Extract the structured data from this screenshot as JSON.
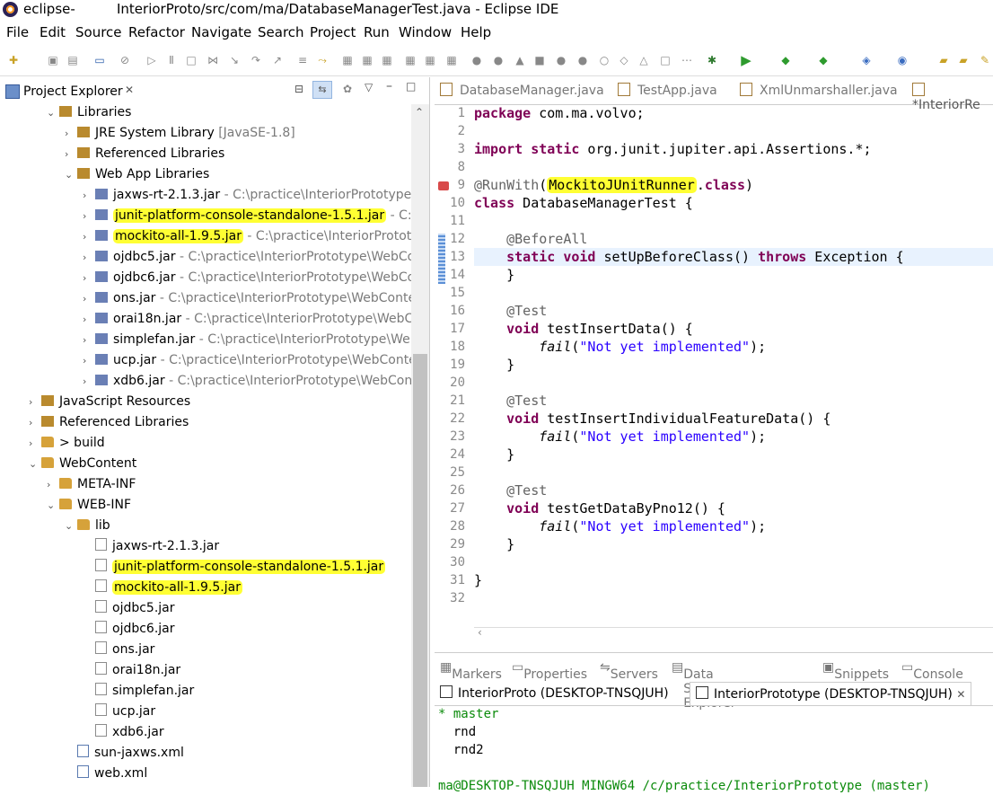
{
  "window": {
    "app_name": "eclipse-",
    "title": "InteriorProto/src/com/ma/DatabaseManagerTest.java - Eclipse IDE"
  },
  "menu": [
    "File",
    "Edit",
    "Source",
    "Refactor",
    "Navigate",
    "Search",
    "Project",
    "Run",
    "Window",
    "Help"
  ],
  "left_panel": {
    "tab_label": "Project Explorer"
  },
  "tree": [
    {
      "label": "Libraries",
      "path": "",
      "level": 2,
      "arrow": "v",
      "icon": "library"
    },
    {
      "label": "JRE System Library",
      "path": " [JavaSE-1.8]",
      "level": 3,
      "arrow": ">",
      "icon": "library"
    },
    {
      "label": "Referenced Libraries",
      "path": "",
      "level": 3,
      "arrow": ">",
      "icon": "library"
    },
    {
      "label": "Web App Libraries",
      "path": "",
      "level": 3,
      "arrow": "v",
      "icon": "library"
    },
    {
      "label": "jaxws-rt-2.1.3.jar",
      "path": " - C:\\practice\\InteriorPrototype\\W",
      "level": 4,
      "arrow": ">",
      "icon": "jar"
    },
    {
      "label": "junit-platform-console-standalone-1.5.1.jar",
      "path": " - C:\\pr",
      "level": 4,
      "arrow": ">",
      "icon": "jar",
      "highlight": true
    },
    {
      "label": "mockito-all-1.9.5.jar",
      "path": " - C:\\practice\\InteriorPrototyp",
      "level": 4,
      "arrow": ">",
      "icon": "jar",
      "highlight": true
    },
    {
      "label": "ojdbc5.jar",
      "path": " - C:\\practice\\InteriorPrototype\\WebCor",
      "level": 4,
      "arrow": ">",
      "icon": "jar"
    },
    {
      "label": "ojdbc6.jar",
      "path": " - C:\\practice\\InteriorPrototype\\WebCor",
      "level": 4,
      "arrow": ">",
      "icon": "jar"
    },
    {
      "label": "ons.jar",
      "path": " - C:\\practice\\InteriorPrototype\\WebConten",
      "level": 4,
      "arrow": ">",
      "icon": "jar"
    },
    {
      "label": "orai18n.jar",
      "path": " - C:\\practice\\InteriorPrototype\\WebCo",
      "level": 4,
      "arrow": ">",
      "icon": "jar"
    },
    {
      "label": "simplefan.jar",
      "path": " - C:\\practice\\InteriorPrototype\\Web(",
      "level": 4,
      "arrow": ">",
      "icon": "jar"
    },
    {
      "label": "ucp.jar",
      "path": " - C:\\practice\\InteriorPrototype\\WebConter",
      "level": 4,
      "arrow": ">",
      "icon": "jar"
    },
    {
      "label": "xdb6.jar",
      "path": " - C:\\practice\\InteriorPrototype\\WebConte",
      "level": 4,
      "arrow": ">",
      "icon": "jar"
    },
    {
      "label": "JavaScript Resources",
      "path": "",
      "level": 1,
      "arrow": ">",
      "icon": "library"
    },
    {
      "label": "Referenced Libraries",
      "path": "",
      "level": 1,
      "arrow": ">",
      "icon": "library"
    },
    {
      "label": "> build",
      "path": "",
      "level": 1,
      "arrow": ">",
      "icon": "folder"
    },
    {
      "label": "WebContent",
      "path": "",
      "level": 1,
      "arrow": "v",
      "icon": "folder"
    },
    {
      "label": "META-INF",
      "path": "",
      "level": 2,
      "arrow": ">",
      "icon": "folder"
    },
    {
      "label": "WEB-INF",
      "path": "",
      "level": 2,
      "arrow": "v",
      "icon": "folder"
    },
    {
      "label": "lib",
      "path": "",
      "level": 3,
      "arrow": "v",
      "icon": "folder"
    },
    {
      "label": "jaxws-rt-2.1.3.jar",
      "path": "",
      "level": 4,
      "arrow": "",
      "icon": "file"
    },
    {
      "label": "junit-platform-console-standalone-1.5.1.jar",
      "path": "",
      "level": 4,
      "arrow": "",
      "icon": "file",
      "highlight": true
    },
    {
      "label": "mockito-all-1.9.5.jar",
      "path": "",
      "level": 4,
      "arrow": "",
      "icon": "file",
      "highlight": true
    },
    {
      "label": "ojdbc5.jar",
      "path": "",
      "level": 4,
      "arrow": "",
      "icon": "file"
    },
    {
      "label": "ojdbc6.jar",
      "path": "",
      "level": 4,
      "arrow": "",
      "icon": "file"
    },
    {
      "label": "ons.jar",
      "path": "",
      "level": 4,
      "arrow": "",
      "icon": "file"
    },
    {
      "label": "orai18n.jar",
      "path": "",
      "level": 4,
      "arrow": "",
      "icon": "file"
    },
    {
      "label": "simplefan.jar",
      "path": "",
      "level": 4,
      "arrow": "",
      "icon": "file"
    },
    {
      "label": "ucp.jar",
      "path": "",
      "level": 4,
      "arrow": "",
      "icon": "file"
    },
    {
      "label": "xdb6.jar",
      "path": "",
      "level": 4,
      "arrow": "",
      "icon": "file"
    },
    {
      "label": "sun-jaxws.xml",
      "path": "",
      "level": 3,
      "arrow": "",
      "icon": "xml"
    },
    {
      "label": "web.xml",
      "path": "",
      "level": 3,
      "arrow": "",
      "icon": "xml"
    }
  ],
  "editor_tabs": [
    "DatabaseManager.java",
    "TestApp.java",
    "XmlUnmarshaller.java",
    "*InteriorRe"
  ],
  "line_numbers": [
    "1",
    "2",
    "3",
    "8",
    "9",
    "10",
    "11",
    "12",
    "13",
    "14",
    "15",
    "16",
    "17",
    "18",
    "19",
    "20",
    "21",
    "22",
    "23",
    "24",
    "25",
    "26",
    "27",
    "28",
    "29",
    "30",
    "31",
    "32"
  ],
  "code_lines": [
    [
      {
        "t": "package",
        "c": "kw"
      },
      {
        "t": " com.ma.volvo;"
      }
    ],
    [],
    [
      {
        "t": "import static",
        "c": "kw"
      },
      {
        "t": " org.junit.jupiter.api.Assertions.*;"
      }
    ],
    [],
    [
      {
        "t": "@RunWith",
        "c": "ann"
      },
      {
        "t": "("
      },
      {
        "t": "MockitoJUnitRunner",
        "c": "hl"
      },
      {
        "t": "."
      },
      {
        "t": "class",
        "c": "kw"
      },
      {
        "t": ")"
      }
    ],
    [
      {
        "t": "class",
        "c": "kw"
      },
      {
        "t": " DatabaseManagerTest {"
      }
    ],
    [],
    [
      {
        "t": "    "
      },
      {
        "t": "@BeforeAll",
        "c": "ann"
      }
    ],
    [
      {
        "t": "    "
      },
      {
        "t": "static void",
        "c": "kw"
      },
      {
        "t": " setUpBeforeClass() "
      },
      {
        "t": "throws",
        "c": "kw"
      },
      {
        "t": " Exception {"
      }
    ],
    [
      {
        "t": "    }"
      }
    ],
    [],
    [
      {
        "t": "    "
      },
      {
        "t": "@Test",
        "c": "ann"
      }
    ],
    [
      {
        "t": "    "
      },
      {
        "t": "void",
        "c": "kw"
      },
      {
        "t": " testInsertData() {"
      }
    ],
    [
      {
        "t": "        "
      },
      {
        "t": "fail",
        "c": "it"
      },
      {
        "t": "("
      },
      {
        "t": "\"Not yet implemented\"",
        "c": "str"
      },
      {
        "t": ");"
      }
    ],
    [
      {
        "t": "    }"
      }
    ],
    [],
    [
      {
        "t": "    "
      },
      {
        "t": "@Test",
        "c": "ann"
      }
    ],
    [
      {
        "t": "    "
      },
      {
        "t": "void",
        "c": "kw"
      },
      {
        "t": " testInsertIndividualFeatureData() {"
      }
    ],
    [
      {
        "t": "        "
      },
      {
        "t": "fail",
        "c": "it"
      },
      {
        "t": "("
      },
      {
        "t": "\"Not yet implemented\"",
        "c": "str"
      },
      {
        "t": ");"
      }
    ],
    [
      {
        "t": "    }"
      }
    ],
    [],
    [
      {
        "t": "    "
      },
      {
        "t": "@Test",
        "c": "ann"
      }
    ],
    [
      {
        "t": "    "
      },
      {
        "t": "void",
        "c": "kw"
      },
      {
        "t": " testGetDataByPno12() {"
      }
    ],
    [
      {
        "t": "        "
      },
      {
        "t": "fail",
        "c": "it"
      },
      {
        "t": "("
      },
      {
        "t": "\"Not yet implemented\"",
        "c": "str"
      },
      {
        "t": ");"
      }
    ],
    [
      {
        "t": "    }"
      }
    ],
    [],
    [
      {
        "t": "}"
      }
    ],
    []
  ],
  "bottom_tabs": [
    "Markers",
    "Properties",
    "Servers",
    "Data Source Explorer",
    "Snippets",
    "Console"
  ],
  "console_tabs": [
    "InteriorProto (DESKTOP-TNSQJUH)",
    "InteriorPrototype (DESKTOP-TNSQJUH)"
  ],
  "console_lines": [
    "* master",
    "  rnd",
    "  rnd2",
    "",
    "ma@DESKTOP-TNSQJUH MINGW64 /c/practice/InteriorPrototype (master)"
  ]
}
